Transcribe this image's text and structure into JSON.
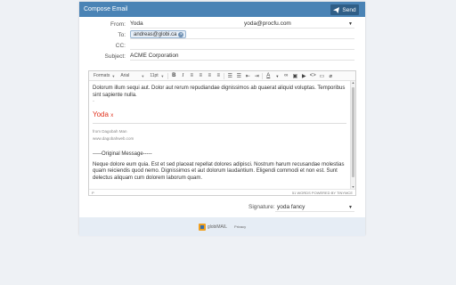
{
  "window": {
    "title": "Compose Email"
  },
  "toolbar": {
    "send_label": "Send"
  },
  "form": {
    "from_label": "From:",
    "from_name": "Yoda",
    "from_email": "yoda@procfu.com",
    "to_label": "To:",
    "to_chip": "andreas@globi.ca",
    "cc_label": "CC:",
    "cc_value": "",
    "subject_label": "Subject:",
    "subject_value": "ACME Corporation"
  },
  "editor": {
    "format_menu": "Formats",
    "font_menu": "Arial",
    "size_menu": "11pt",
    "paragraph1": "Dolorum illum sequi aut. Dolor aut rerum repudiandae dignissimos ab quaerat aliquid voluptas. Temporibus sint sapiente nulla.",
    "dash": "-",
    "sig_name": "Yoda",
    "sig_mark": "x",
    "sig_from": "from Dagobah Man",
    "sig_site": "www.dagobahweb.com",
    "original_header": "-----Original Message-----",
    "paragraph2": "Neque dolore eum quia. Est et sed placeat repellat dolores adipisci. Nostrum harum recusandae molestias quam reiciendis quod nemo. Dignissimos et aut dolorum laudantium. Eligendi commodi et non est. Sunt delectus aliquam cum dolorem laborum quam.",
    "status_path": "P",
    "status_right": "51 WORDS POWERED BY TINYMCE"
  },
  "signature": {
    "label": "Signature:",
    "value": "yoda fancy"
  },
  "footer": {
    "logo_text": "globiMAIL",
    "note": "Privacy"
  },
  "colors": {
    "titlebar": "#4a83b5",
    "send_button": "#2f5e87",
    "signature_red": "#e0321d",
    "footer_bg": "#e6edf5"
  }
}
